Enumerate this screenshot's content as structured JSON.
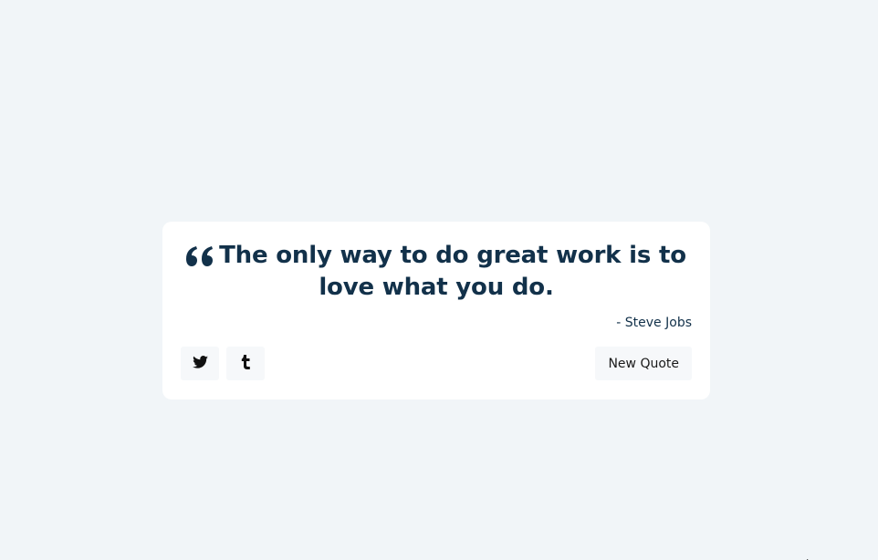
{
  "quote": {
    "icon": "quote-left-icon",
    "text": "The only way to do great work is to love what you do.",
    "author": "- Steve Jobs"
  },
  "actions": {
    "twitter_icon": "twitter-icon",
    "tumblr_icon": "tumblr-icon",
    "new_quote_label": "New Quote"
  },
  "colors": {
    "background": "#f1f5f8",
    "card": "#ffffff",
    "text": "#12314a",
    "button": "#f6f8fa"
  }
}
